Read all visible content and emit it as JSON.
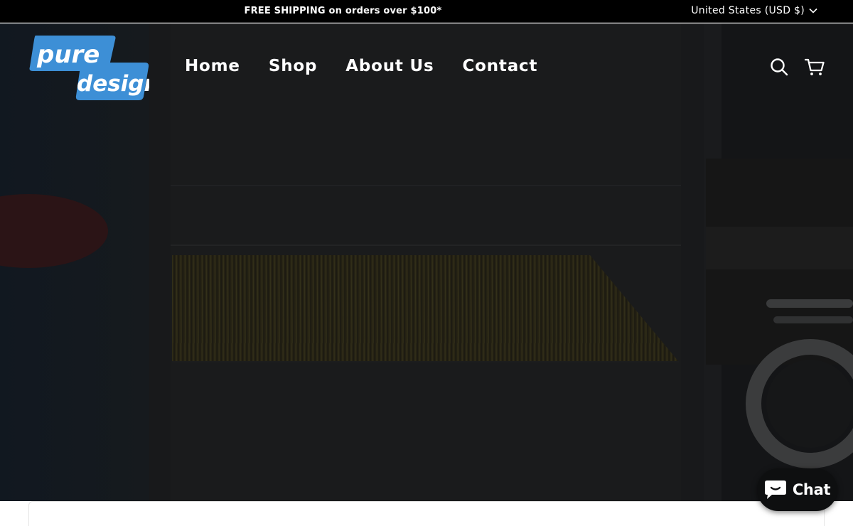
{
  "announcement": {
    "promo_text": "FREE SHIPPING on orders over $100*",
    "currency_label": "United States (USD $)"
  },
  "header": {
    "logo": {
      "line1": "pure",
      "line2": "design",
      "color": "#3d8fd6"
    },
    "nav": [
      {
        "label": "Home"
      },
      {
        "label": "Shop"
      },
      {
        "label": "About Us"
      },
      {
        "label": "Contact"
      }
    ],
    "icons": {
      "search": "search-icon",
      "cart": "cart-icon"
    }
  },
  "chat": {
    "label": "Chat",
    "icon": "chat-bubble-icon"
  },
  "colors": {
    "announcement_bg": "#000000",
    "hero_overlay": "#151618",
    "logo_blue": "#3d8fd6",
    "nav_text": "#ffffff"
  }
}
